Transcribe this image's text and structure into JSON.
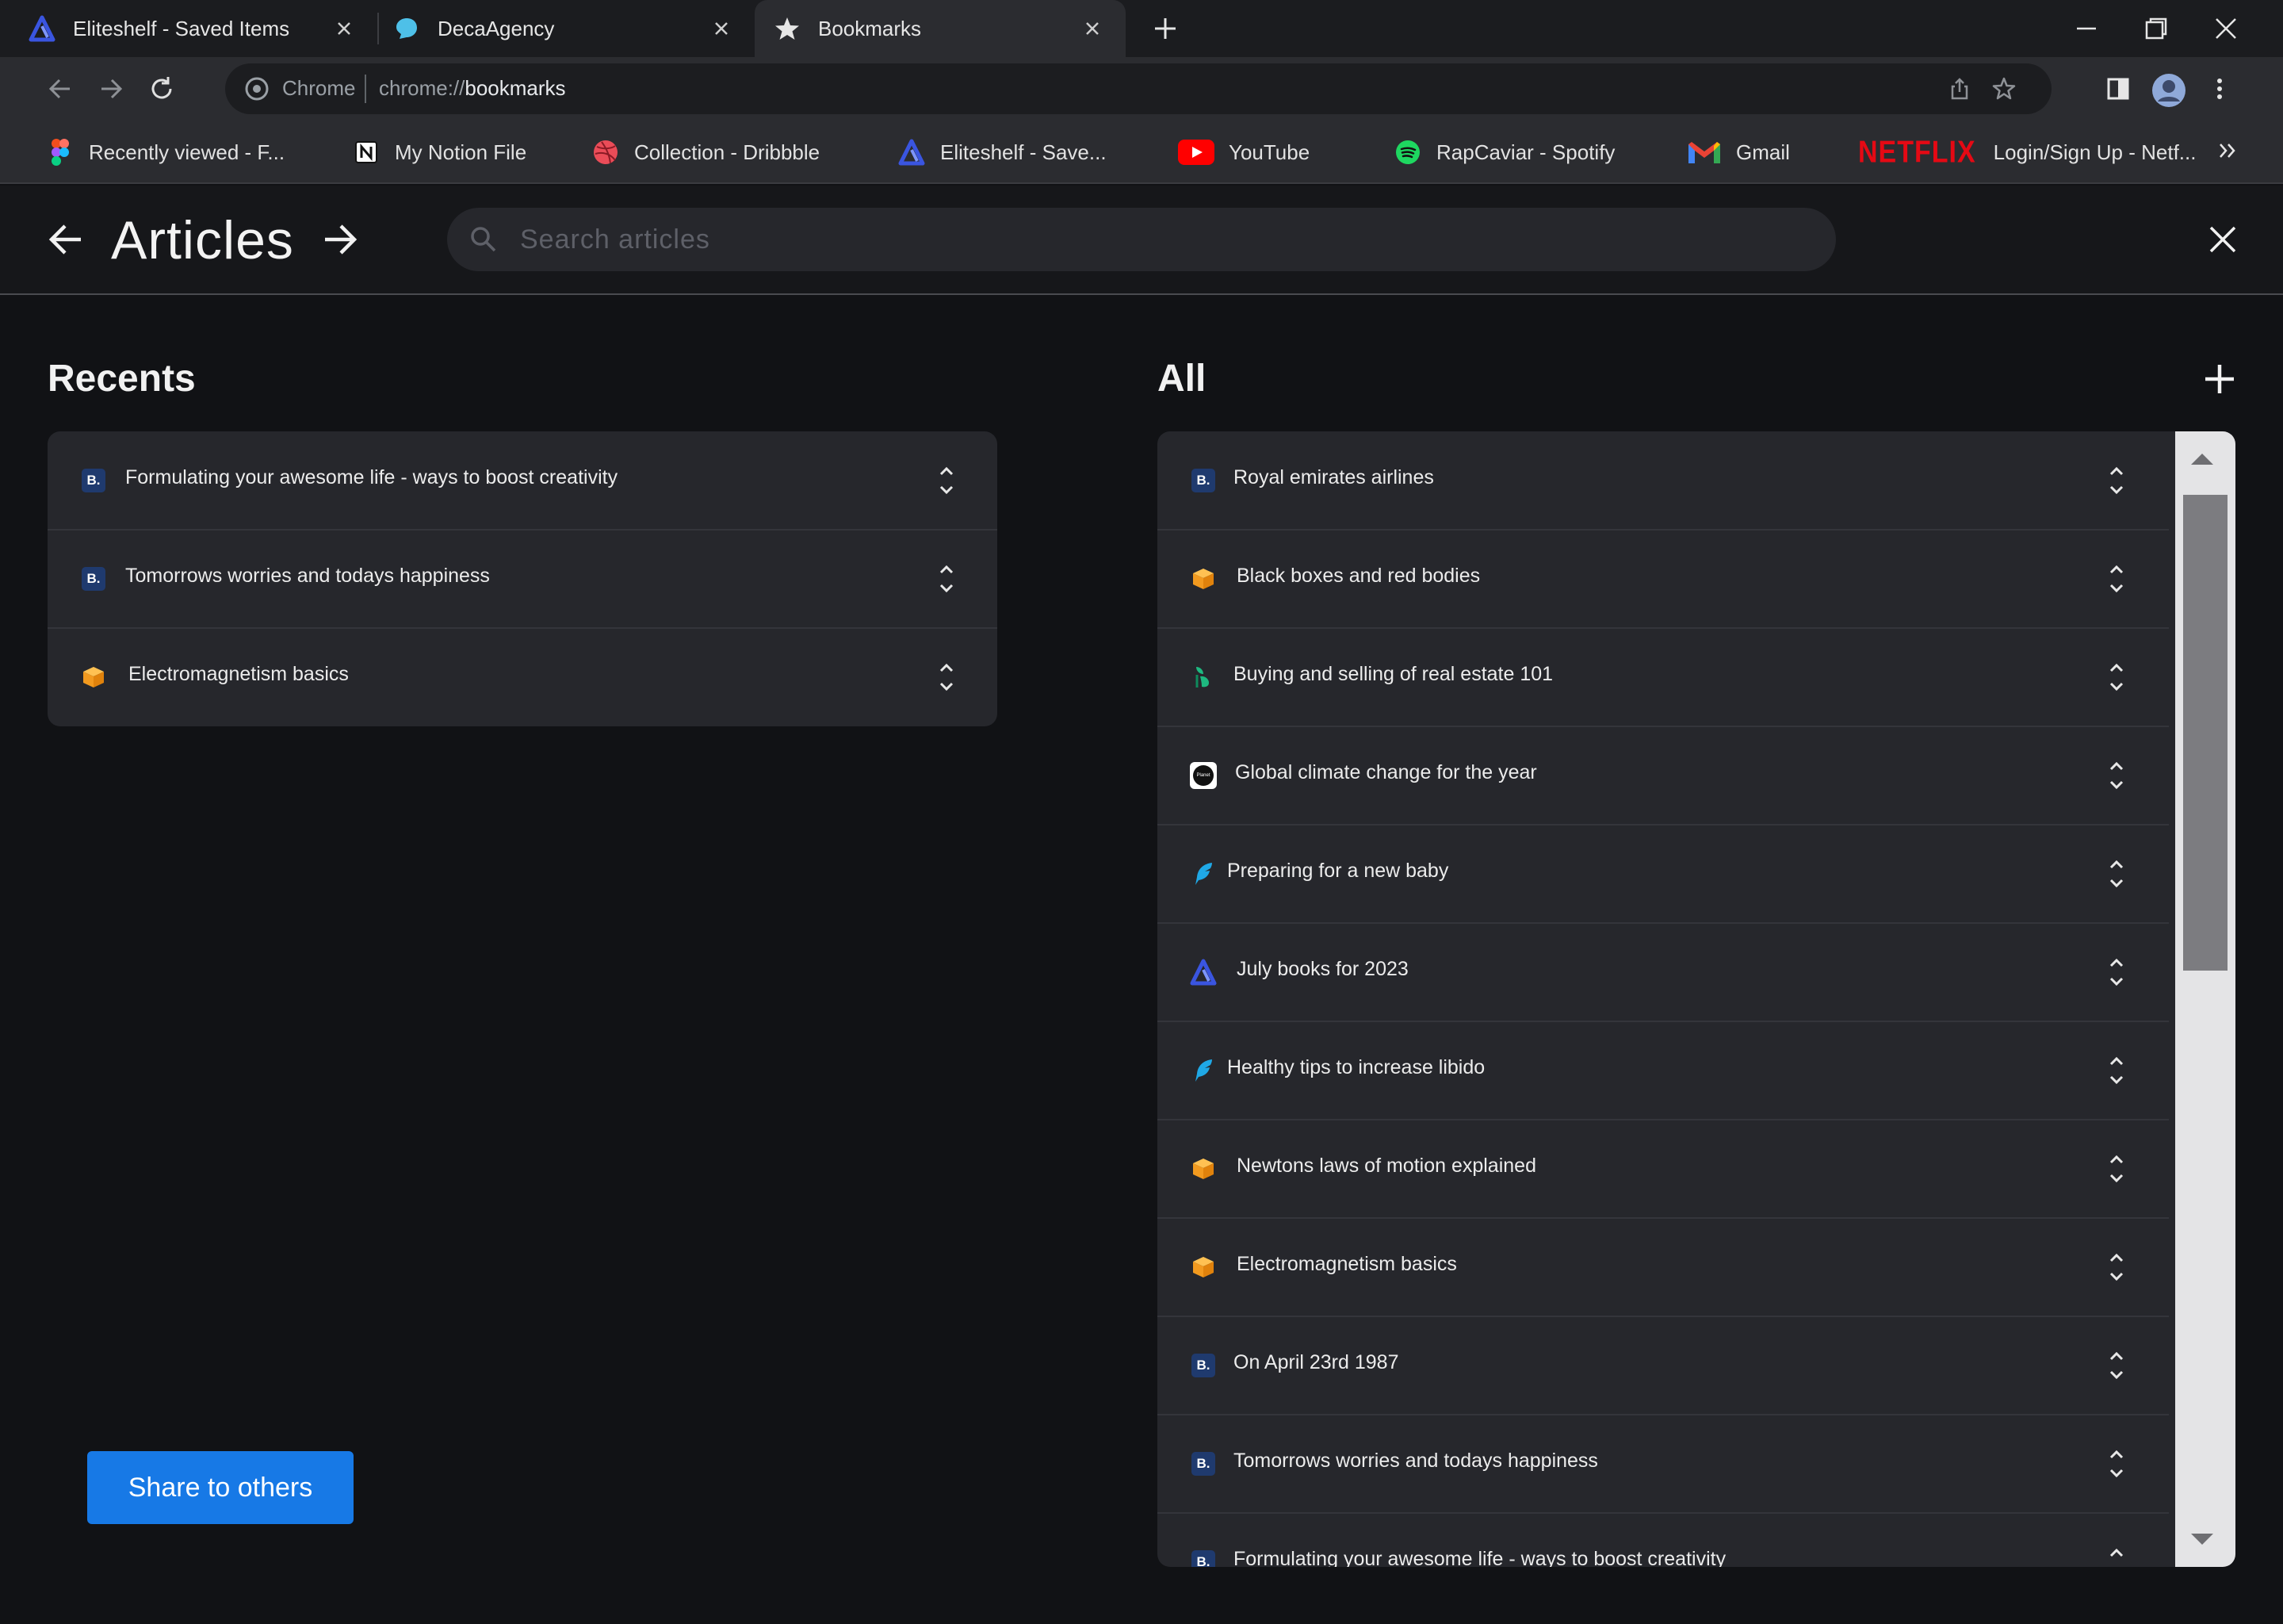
{
  "browser": {
    "tabs": [
      {
        "title": "Eliteshelf - Saved Items",
        "icon": "eliteshelf-logo-icon",
        "active": false
      },
      {
        "title": "DecaAgency",
        "icon": "decaagency-logo-icon",
        "active": false
      },
      {
        "title": "Bookmarks",
        "icon": "star-icon",
        "active": true
      }
    ],
    "omnibox": {
      "chip": "Chrome",
      "url_scheme": "chrome://",
      "url_path": "bookmarks"
    },
    "bookmarks_bar": [
      {
        "label": "Recently viewed - F...",
        "icon": "figma-icon"
      },
      {
        "label": "My Notion File",
        "icon": "notion-icon"
      },
      {
        "label": "Collection - Dribbble",
        "icon": "dribbble-icon"
      },
      {
        "label": "Eliteshelf - Save...",
        "icon": "eliteshelf-logo-icon"
      },
      {
        "label": "YouTube",
        "icon": "youtube-icon"
      },
      {
        "label": "RapCaviar - Spotify",
        "icon": "spotify-icon"
      },
      {
        "label": "Gmail",
        "icon": "gmail-icon"
      },
      {
        "label": "Login/Sign Up - Netf...",
        "icon": "netflix-icon",
        "icon_text": "NETFLIX"
      }
    ]
  },
  "header": {
    "title": "Articles",
    "search_placeholder": "Search articles"
  },
  "recents": {
    "title": "Recents",
    "items": [
      {
        "label": "Formulating your awesome life - ways to boost creativity",
        "icon": "b-badge-icon",
        "icon_text": "B."
      },
      {
        "label": "Tomorrows worries and todays happiness",
        "icon": "b-badge-icon",
        "icon_text": "B."
      },
      {
        "label": "Electromagnetism basics",
        "icon": "box-icon"
      }
    ]
  },
  "all": {
    "title": "All",
    "items": [
      {
        "label": "Royal emirates airlines",
        "icon": "b-badge-icon",
        "icon_text": "B."
      },
      {
        "label": "Black boxes and red bodies",
        "icon": "box-icon"
      },
      {
        "label": "Buying and selling of real estate 101",
        "icon": "green-leaf-icon"
      },
      {
        "label": "Global climate change for the year",
        "icon": "circle-logo-icon",
        "icon_text": "Planet"
      },
      {
        "label": "Preparing for a new baby",
        "icon": "feather-icon"
      },
      {
        "label": "July books for 2023",
        "icon": "eliteshelf-logo-icon"
      },
      {
        "label": "Healthy tips to increase libido",
        "icon": "feather-icon"
      },
      {
        "label": "Newtons laws of motion explained",
        "icon": "box-icon"
      },
      {
        "label": "Electromagnetism basics",
        "icon": "box-icon"
      },
      {
        "label": "On April 23rd 1987",
        "icon": "b-badge-icon",
        "icon_text": "B."
      },
      {
        "label": "Tomorrows worries and todays happiness",
        "icon": "b-badge-icon",
        "icon_text": "B."
      },
      {
        "label": "Formulating your awesome life - ways to boost creativity",
        "icon": "b-badge-icon",
        "icon_text": "B."
      }
    ]
  },
  "actions": {
    "share_label": "Share to others"
  },
  "colors": {
    "accent": "#1779e6",
    "background": "#111215",
    "card": "#26272c"
  }
}
